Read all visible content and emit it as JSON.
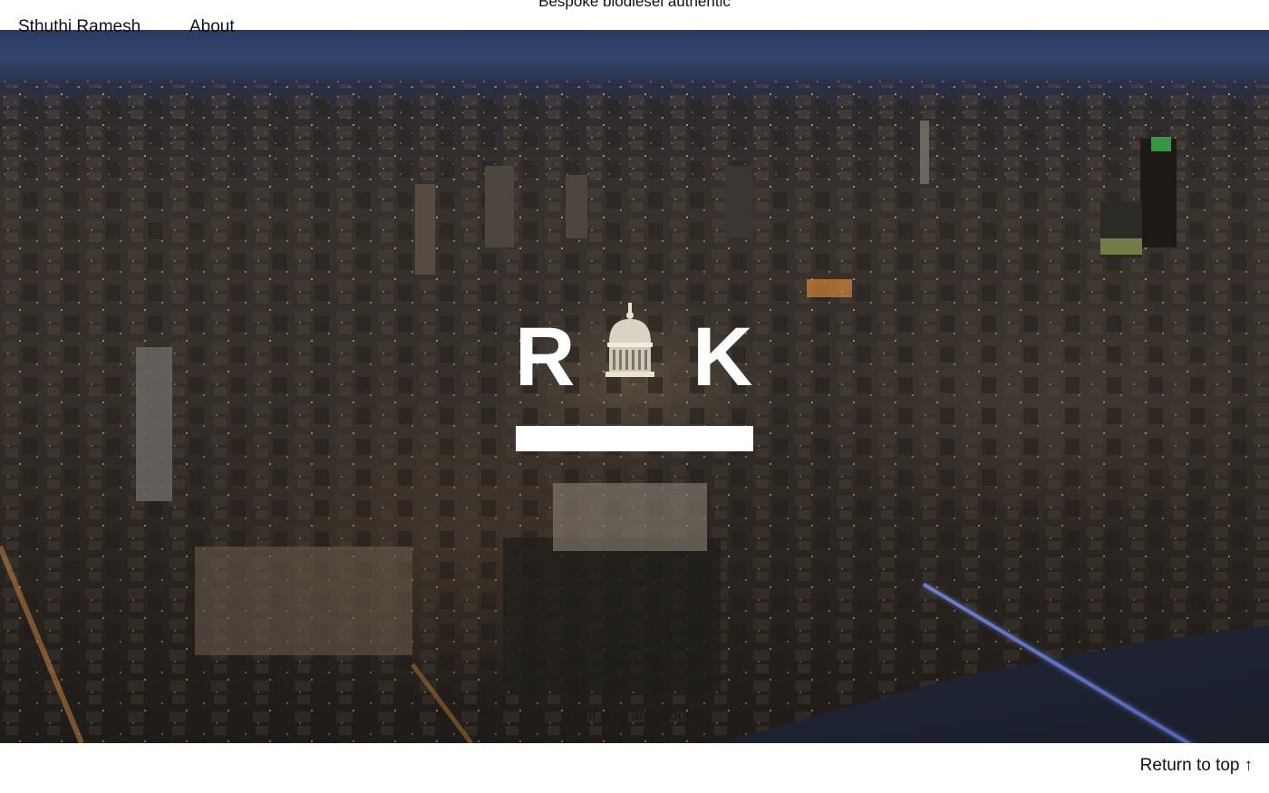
{
  "header": {
    "site_name": "Sthuthi Ramesh",
    "nav_about": "About",
    "tagline": "Bespoke biodiesel authentic"
  },
  "hero": {
    "image_description_icon": "city-night-aerial-image",
    "logo": {
      "letter_left": "R",
      "letter_right": "K"
    },
    "caption": "Wolf pug adaptogen"
  },
  "footer": {
    "return_to_top": "Return to top",
    "return_arrow": "↑"
  },
  "colors": {
    "sky": "#34456e",
    "city": "#3c3530",
    "river": "#1b1f2c",
    "bridge": "#4a5fb5",
    "logo": "#ffffff"
  }
}
